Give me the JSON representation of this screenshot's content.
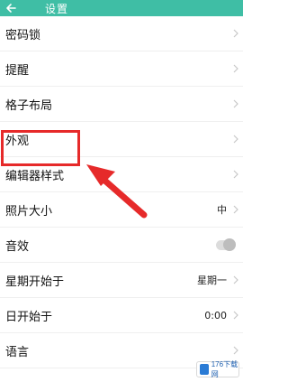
{
  "header": {
    "title": "设置",
    "back_icon": "arrow-left-icon",
    "bg_color": "#3fbea5"
  },
  "settings": [
    {
      "label": "密码锁",
      "value": "",
      "chevron": true
    },
    {
      "label": "提醒",
      "value": "",
      "chevron": true
    },
    {
      "label": "格子布局",
      "value": "",
      "chevron": true
    },
    {
      "label": "外观",
      "value": "",
      "chevron": true
    },
    {
      "label": "编辑器样式",
      "value": "",
      "chevron": true
    },
    {
      "label": "照片大小",
      "value": "中",
      "chevron": true
    },
    {
      "label": "音效",
      "value": "",
      "toggle": true
    },
    {
      "label": "星期开始于",
      "value": "星期一",
      "chevron": true
    },
    {
      "label": "日开始于",
      "value": "0:00",
      "chevron": true
    },
    {
      "label": "语言",
      "value": "",
      "chevron": true
    }
  ],
  "annotation": {
    "highlight_color": "#e62a2a"
  },
  "watermark": {
    "text": "176下载网"
  }
}
